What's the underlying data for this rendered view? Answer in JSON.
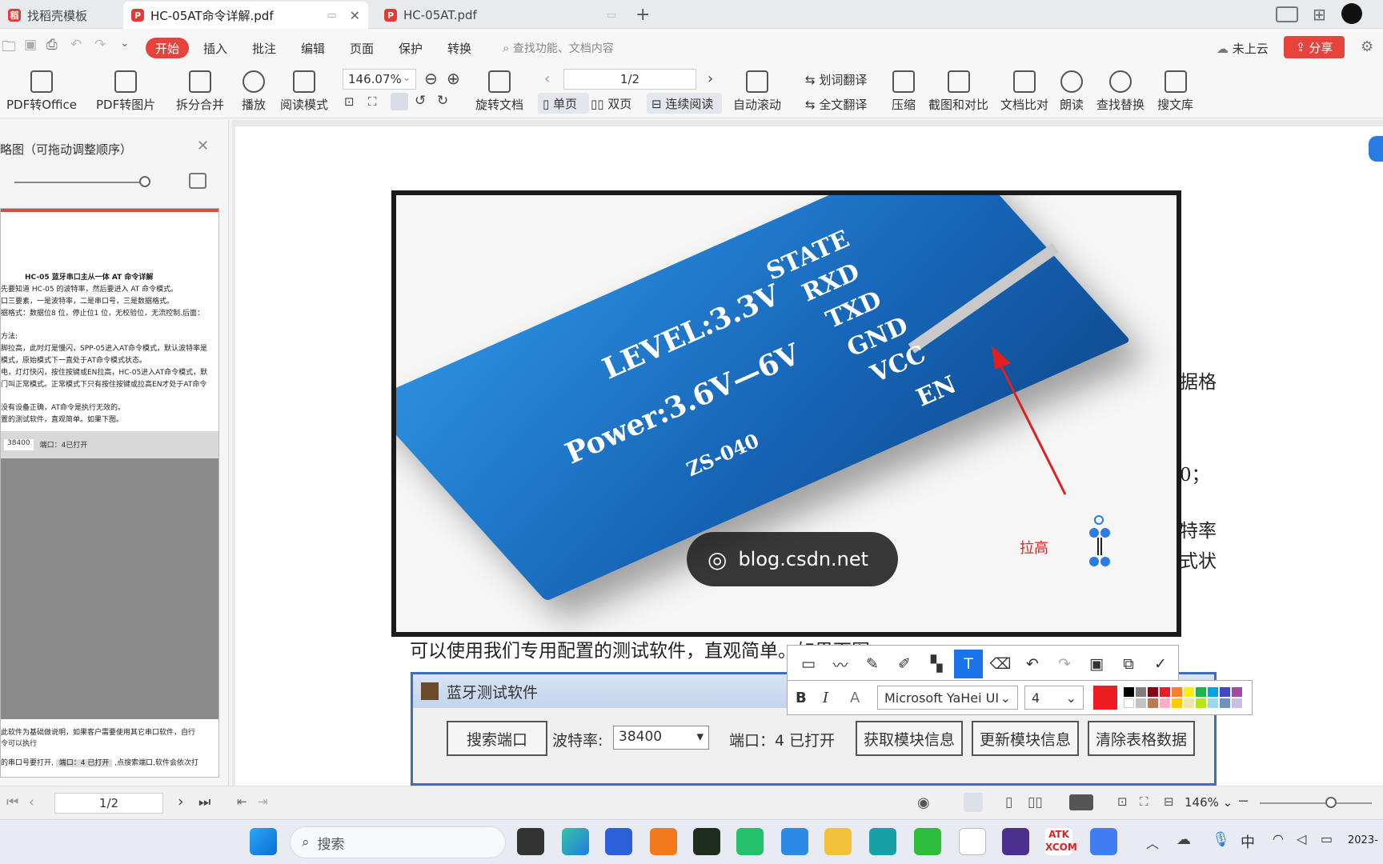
{
  "tabs": [
    {
      "label": "找稻壳模板"
    },
    {
      "label": "HC-05AT命令详解.pdf"
    },
    {
      "label": "HC-05AT.pdf"
    }
  ],
  "menu": {
    "start": "开始",
    "items": [
      "插入",
      "批注",
      "编辑",
      "页面",
      "保护",
      "转换"
    ],
    "search_placeholder": "查找功能、文档内容",
    "cloud": "未上云",
    "share": "分享"
  },
  "ribbon": {
    "pdf_to_office": "PDF转Office",
    "pdf_to_image": "PDF转图片",
    "split_merge": "拆分合并",
    "play": "播放",
    "read_mode": "阅读模式",
    "zoom": "146.07%",
    "rotate": "旋转文档",
    "page_indicator": "1/2",
    "single_page": "单页",
    "double_page": "双页",
    "continuous": "连续阅读",
    "auto_scroll": "自动滚动",
    "word_translate": "划词翻译",
    "full_translate": "全文翻译",
    "compress": "压缩",
    "screenshot_compare": "截图和对比",
    "doc_compare": "文档比对",
    "read_aloud": "朗读",
    "find_replace": "查找替换",
    "search_lib": "搜文库"
  },
  "left_panel": {
    "title": "略图（可拖动调整顺序）",
    "thumb_lines": [
      "HC-05 蓝牙串口主从一体 AT 命令详解",
      "先要知道 HC-05 的波特率，然后要进入 AT 命令模式。",
      "口三要素，一是波特率，二是串口号，三是数据格式。",
      "据格式：数据位8 位，停止位1 位，无校验位，无流控制.后面：",
      "方法:",
      "脚拉高，此时灯是慢闪，SPP-05进入AT命令模式，默认波特率是",
      "模式，原始模式下一直处于AT命令模式状态。",
      "电，灯灯快闪，按住按键或EN拉高，HC-05进入AT命令模式，默",
      "门叫正常模式。正常模式下只有按住按键或拉高EN才处于AT命令",
      "没有设备正确，AT命令是执行无效的。",
      "置的测试软件，直观简单。如果下图。"
    ],
    "thumb_sw_baud": "38400",
    "thumb_sw_port": "端口：4已打开",
    "thumb_bottom_1": "此软件为基础做说明，如果客户需要使用其它串口软件，自行",
    "thumb_bottom_2": "令可以执行",
    "thumb_bottom_3": "的串口号要打开,",
    "thumb_bottom_4": "端口：4 已打开",
    "thumb_bottom_5": ",点搜索端口,软件会依次打"
  },
  "figure": {
    "silk_state": "STATE",
    "silk_rxd": "RXD",
    "silk_txd": "TXD",
    "silk_gnd": "GND",
    "silk_vcc": "VCC",
    "silk_en": "EN",
    "silk_level": "LEVEL:3.3V",
    "silk_power": "Power:3.6V—6V",
    "silk_zs": "ZS-040",
    "watermark": "blog.csdn.net",
    "annotation": "拉高"
  },
  "body_text": {
    "line_bottom": "可以使用我们专用配置的测试软件，直观简单。如果下图。",
    "frag_1": "据格",
    "frag_2": "0；",
    "frag_3": "特率",
    "frag_4": "式状"
  },
  "anno_toolbar": {
    "font": "Microsoft YaHei UI",
    "size": "4",
    "accent": "#1a73e8",
    "current_color": "#ee1c25"
  },
  "bt_software": {
    "title": "蓝牙测试软件",
    "search_port": "搜索端口",
    "baud_label": "波特率:",
    "baud_value": "38400",
    "port_status": "端口：4 已打开",
    "get_info": "获取模块信息",
    "update_info": "更新模块信息",
    "clear_table": "清除表格数据"
  },
  "status": {
    "page": "1/2",
    "zoom": "146%"
  },
  "taskbar": {
    "search": "搜索",
    "ime": "中",
    "clock": "2023-"
  }
}
